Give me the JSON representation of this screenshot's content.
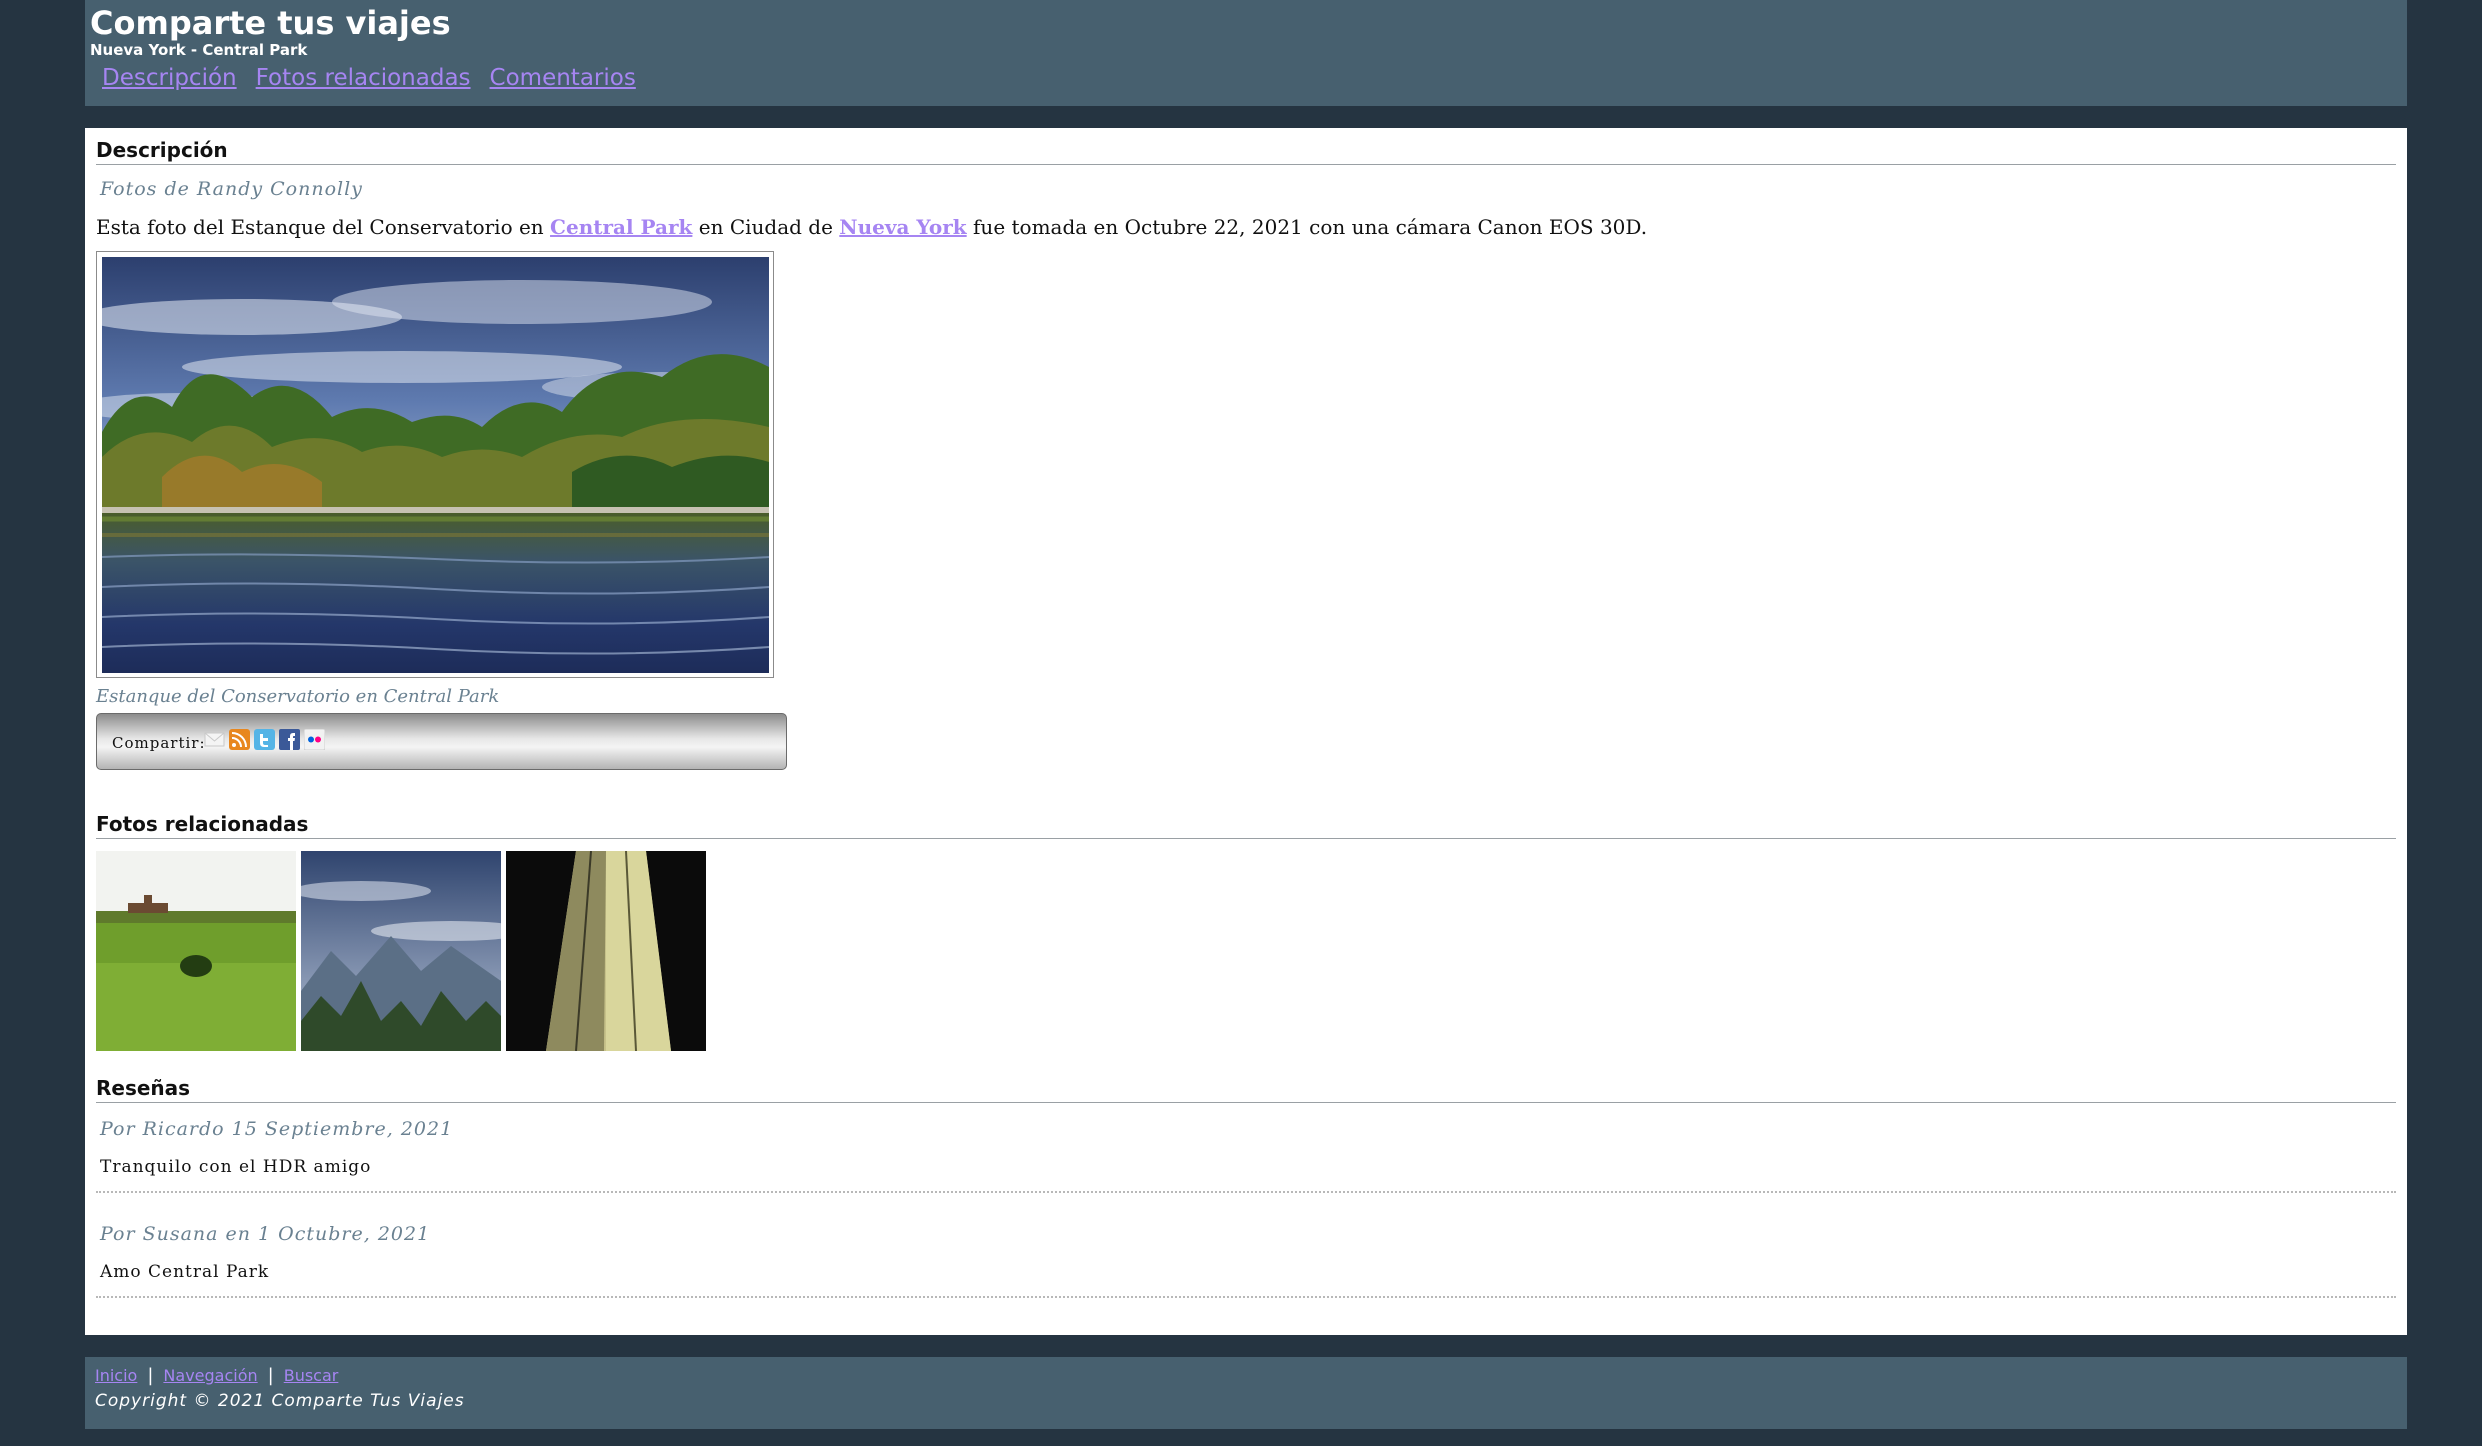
{
  "header": {
    "title": "Comparte tus viajes",
    "subtitle": "Nueva York - Central Park",
    "nav": [
      {
        "label": "Descripción"
      },
      {
        "label": "Fotos relacionadas"
      },
      {
        "label": "Comentarios"
      }
    ]
  },
  "description": {
    "heading": "Descripción",
    "byline": "Fotos de Randy Connolly",
    "text_before_link1": "Esta foto del Estanque del Conservatorio en ",
    "link1": "Central Park",
    "text_between": " en Ciudad de ",
    "link2": "Nueva York",
    "text_after": " fue tomada en Octubre 22, 2021 con una cámara Canon EOS 30D.",
    "caption": "Estanque del Conservatorio en Central Park",
    "share_label": "Compartir:",
    "share_icons": [
      "email-icon",
      "rss-icon",
      "twitter-icon",
      "facebook-icon",
      "flickr-icon"
    ]
  },
  "related": {
    "heading": "Fotos relacionadas"
  },
  "reviews": {
    "heading": "Reseñas",
    "items": [
      {
        "by": "Por Ricardo 15 Septiembre, 2021",
        "text": "Tranquilo con el HDR amigo"
      },
      {
        "by": "Por Susana en 1 Octubre, 2021",
        "text": "Amo Central Park"
      }
    ]
  },
  "footer": {
    "links": [
      {
        "label": "Inicio"
      },
      {
        "label": "Navegación"
      },
      {
        "label": "Buscar"
      }
    ],
    "separator": "|",
    "copyright": "Copyright © 2021 Comparte Tus Viajes"
  },
  "colors": {
    "background": "#253441",
    "bar": "#47606f",
    "link": "#a685f2",
    "muted": "#6a8191"
  }
}
